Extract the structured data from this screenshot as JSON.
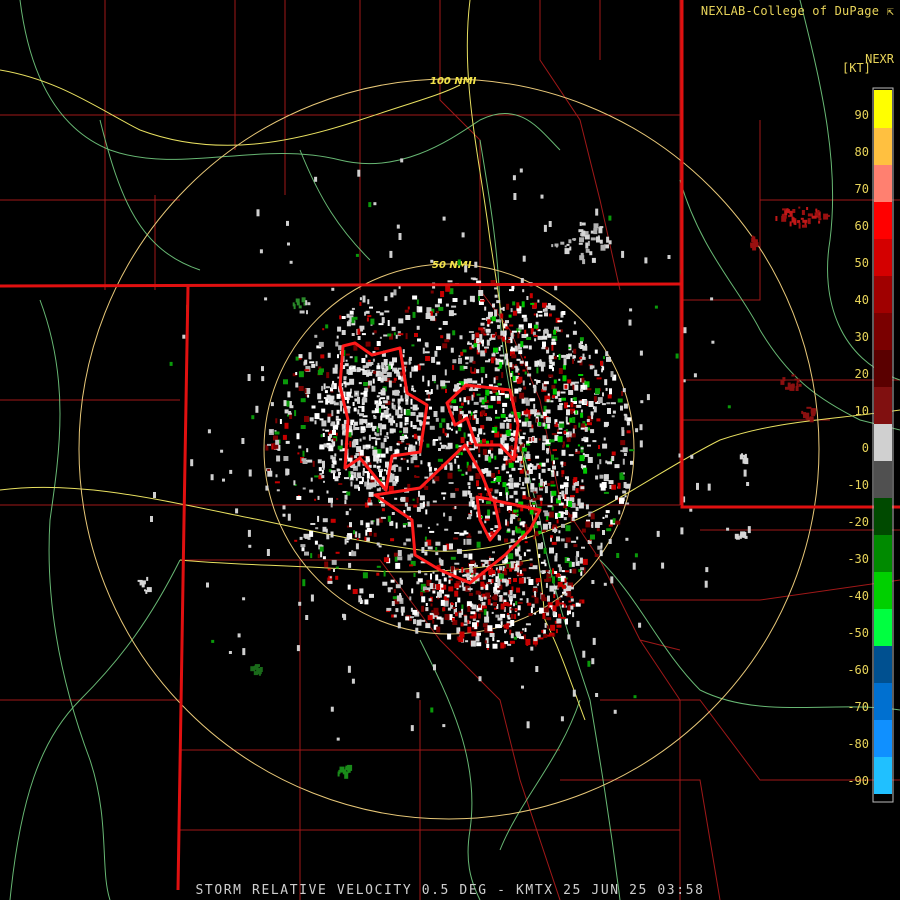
{
  "header": {
    "credit": "NEXLAB-College of DuPage",
    "product": "NEXR"
  },
  "footer": {
    "caption": "STORM RELATIVE VELOCITY 0.5 DEG - KMTX 25 JUN 25 03:58"
  },
  "range_rings": [
    {
      "label": "100 NMI"
    },
    {
      "label": "50 NMI"
    }
  ],
  "legend": {
    "units": "[KT]",
    "ticks": [
      "90",
      "80",
      "70",
      "60",
      "50",
      "40",
      "30",
      "20",
      "10",
      "0",
      "-10",
      "-20",
      "-30",
      "-40",
      "-50",
      "-60",
      "-70",
      "-80",
      "-90"
    ],
    "colors": [
      "#ffff00",
      "#ffc040",
      "#ff8070",
      "#ff0000",
      "#d40000",
      "#a00000",
      "#7a0000",
      "#5a0000",
      "#801010",
      "#d0d0d0",
      "#505050",
      "#004a00",
      "#008a00",
      "#00d000",
      "#00ff40",
      "#005090",
      "#0070d0",
      "#1090ff",
      "#20c0ff"
    ]
  },
  "colors": {
    "state_border": "#e01010",
    "county_line": "#a01818",
    "highway": "#e8e060",
    "river": "#7ad888",
    "range_ring": "#e8c878",
    "warning_polygon": "#ff1a1a"
  },
  "icons": {
    "credit_logo": "nexlab-arrow-icon"
  }
}
